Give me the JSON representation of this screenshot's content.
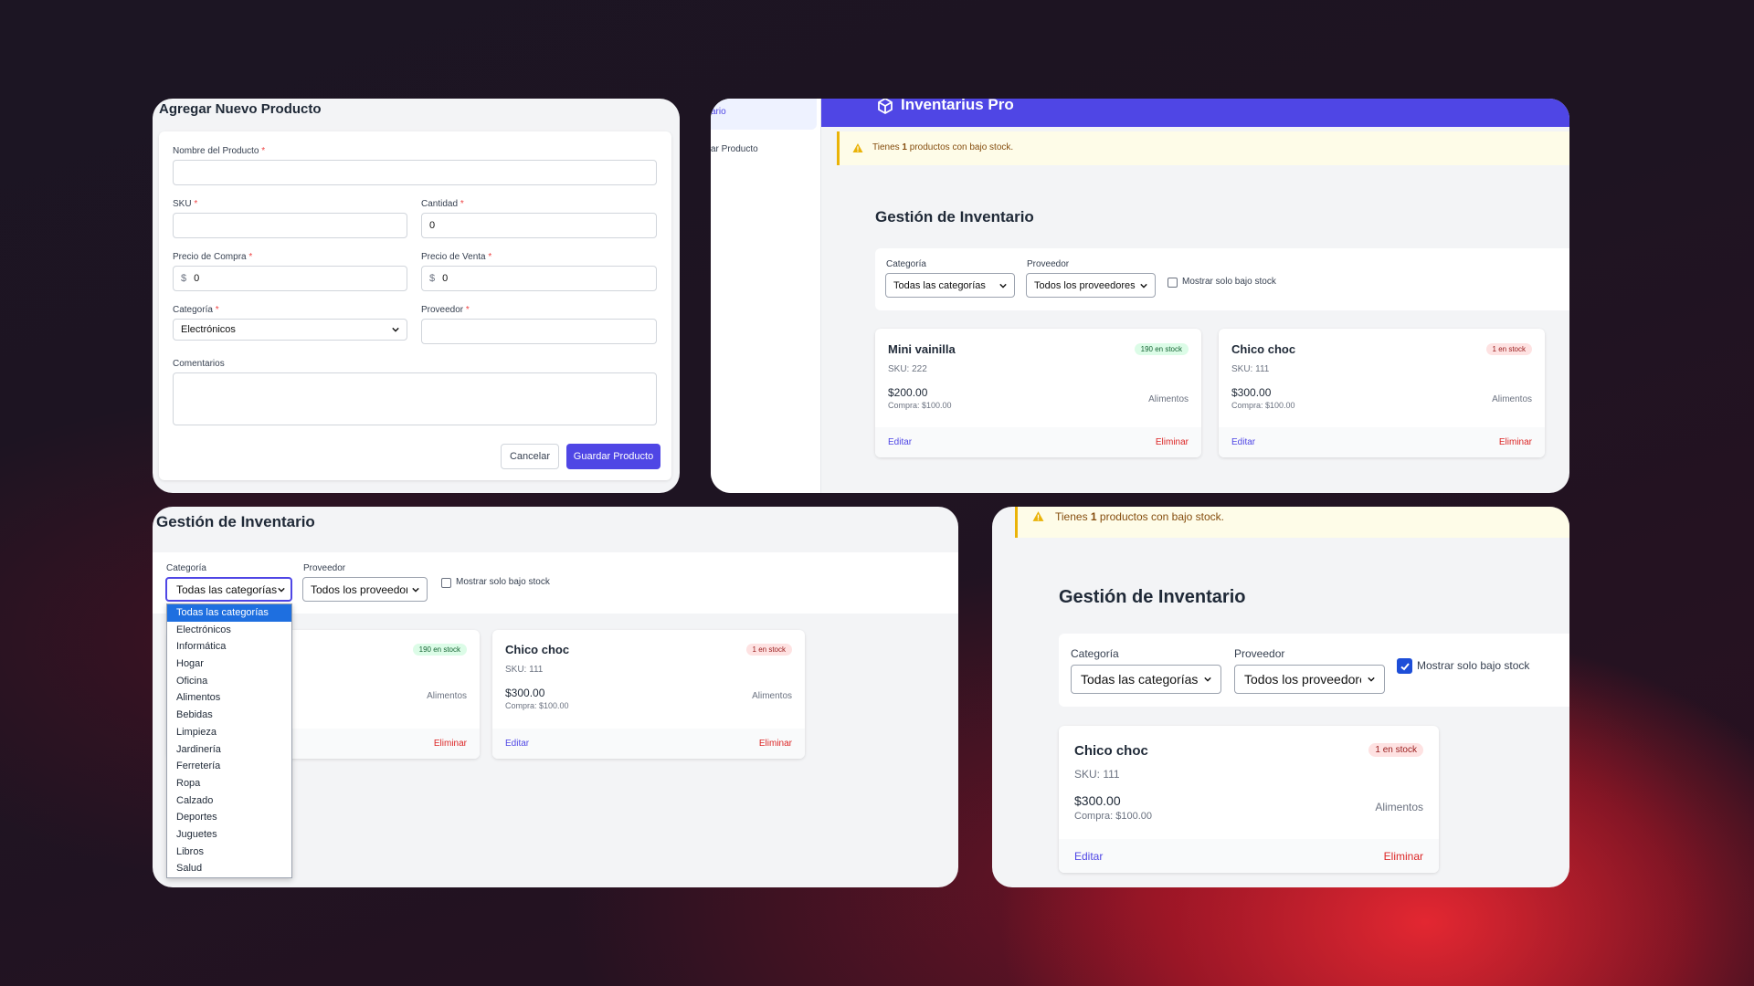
{
  "form": {
    "title": "Agregar Nuevo Producto",
    "name_label": "Nombre del Producto",
    "sku_label": "SKU",
    "quantity_label": "Cantidad",
    "quantity_value": "0",
    "buy_price_label": "Precio de Compra",
    "buy_price_value": "0",
    "sell_price_label": "Precio de Venta",
    "sell_price_value": "0",
    "currency_symbol": "$",
    "category_label": "Categoría",
    "category_value": "Electrónicos",
    "supplier_label": "Proveedor",
    "comments_label": "Comentarios",
    "required_mark": "*",
    "cancel_label": "Cancelar",
    "save_label": "Guardar Producto"
  },
  "app": {
    "brand": "Inventarius Pro",
    "sidebar_item_1": "ario",
    "sidebar_item_2": "ar Producto",
    "alert": {
      "prefix": "Tienes ",
      "count": "1",
      "suffix": " productos con bajo stock."
    }
  },
  "inventory": {
    "title": "Gestión de Inventario",
    "category_label": "Categoría",
    "category_value": "Todas las categorías",
    "supplier_label": "Proveedor",
    "supplier_value": "Todos los proveedores",
    "low_stock_label": "Mostrar solo bajo stock",
    "edit_label": "Editar",
    "delete_label": "Eliminar",
    "products": [
      {
        "name": "Mini vainilla",
        "sku": "SKU: 222",
        "price": "$200.00",
        "buy": "Compra: $100.00",
        "category": "Alimentos",
        "stock": "190 en stock"
      },
      {
        "name": "Chico choc",
        "sku": "SKU: 111",
        "price": "$300.00",
        "buy": "Compra: $100.00",
        "category": "Alimentos",
        "stock": "1 en stock"
      }
    ],
    "category_options": [
      "Todas las categorías",
      "Electrónicos",
      "Informática",
      "Hogar",
      "Oficina",
      "Alimentos",
      "Bebidas",
      "Limpieza",
      "Jardinería",
      "Ferretería",
      "Ropa",
      "Calzado",
      "Deportes",
      "Juguetes",
      "Libros",
      "Salud"
    ]
  },
  "colors": {
    "accent": "#4f46e5",
    "danger": "#dc2626",
    "warning": "#eab308"
  }
}
